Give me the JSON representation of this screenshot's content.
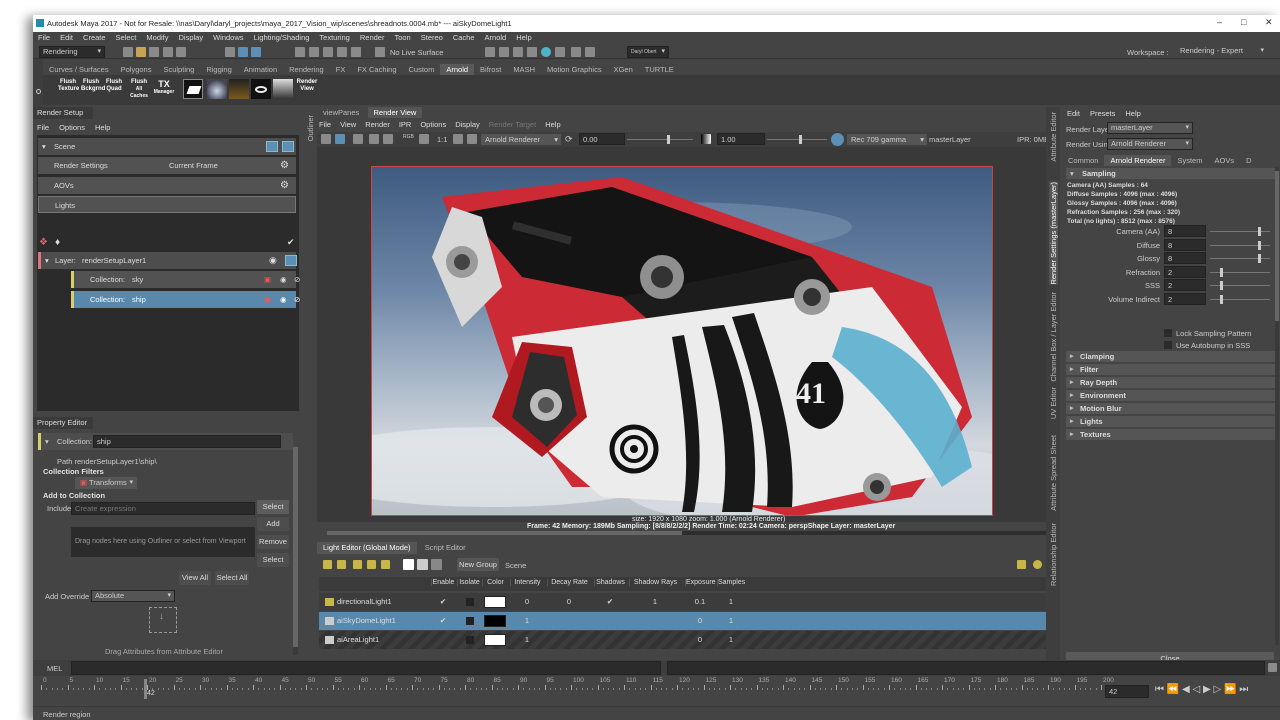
{
  "window": {
    "title": "Autodesk Maya 2017 - Not for Resale: \\\\nas\\Daryl\\daryl_projects\\maya_2017_Vision_wip\\scenes\\shreadnots.0004.mb*  ---  aiSkyDomeLight1"
  },
  "menubar": [
    "File",
    "Edit",
    "Create",
    "Select",
    "Modify",
    "Display",
    "Windows",
    "Lighting/Shading",
    "Texturing",
    "Render",
    "Toon",
    "Stereo",
    "Cache",
    "Arnold",
    "Help"
  ],
  "status": {
    "menuset": "Rendering",
    "live_surface": "No Live Surface",
    "object_field": "Daryl Obert",
    "workspace_label": "Workspace :",
    "workspace": "Rendering - Expert"
  },
  "shelf": {
    "tabs": [
      "Curves / Surfaces",
      "Polygons",
      "Sculpting",
      "Rigging",
      "Animation",
      "Rendering",
      "FX",
      "FX Caching",
      "Custom",
      "Arnold",
      "Bifrost",
      "MASH",
      "Motion Graphics",
      "XGen",
      "TURTLE"
    ],
    "active_tab": "Arnold",
    "buttons": [
      {
        "line1": "Flush",
        "line2": "Texture"
      },
      {
        "line1": "Flush",
        "line2": "Bckgrnd"
      },
      {
        "line1": "Flush",
        "line2": "Quad"
      },
      {
        "line1": "Flush",
        "line2": "All Caches"
      },
      {
        "line1": "TX",
        "line2": "Manager"
      },
      {
        "line1": "Render",
        "line2": "View"
      }
    ]
  },
  "render_setup": {
    "title": "Render Setup",
    "menu": [
      "File",
      "Options",
      "Help"
    ],
    "scene_label": "Scene",
    "render_settings": "Render Settings",
    "current_frame": "Current Frame",
    "aovs": "AOVs",
    "lights": "Lights",
    "layer_label": "Layer:",
    "layer_name": "renderSetupLayer1",
    "collections": [
      {
        "label": "Collection:",
        "name": "sky",
        "selected": false
      },
      {
        "label": "Collection:",
        "name": "ship",
        "selected": true
      }
    ]
  },
  "property_editor": {
    "title": "Property Editor",
    "collection_label": "Collection:",
    "collection_name": "ship",
    "path": "Path renderSetupLayer1\\ship\\",
    "filters_label": "Collection Filters",
    "filter_value": "Transforms",
    "add_label": "Add to Collection",
    "include_label": "Include",
    "include_placeholder": "Create expression",
    "select_btn": "Select",
    "add_btn": "Add",
    "remove_btn": "Remove",
    "select2_btn": "Select",
    "drag_hint": "Drag nodes here using Outliner or select from Viewport",
    "view_all": "View All",
    "select_all": "Select All",
    "override_label": "Add Override",
    "override_value": "Absolute",
    "drag_attr": "Drag Attributes from Attribute Editor"
  },
  "side_tabs": {
    "outliner": "Outliner"
  },
  "render_view": {
    "tabs": [
      "viewPanes",
      "Render View"
    ],
    "menu": [
      "File",
      "View",
      "Render",
      "IPR",
      "Options",
      "Display",
      "Render Target",
      "Help"
    ],
    "renderer": "Arnold Renderer",
    "exposure": "0.00",
    "gamma": "1.00",
    "color_space": "Rec 709 gamma",
    "layer": "masterLayer",
    "ipr": "IPR: 0MB",
    "info_line1": "size: 1920 x 1080  zoom: 1.000     (Arnold Renderer)",
    "info_line2": "Frame: 42     Memory: 189Mb     Sampling: [8/8/8/2/2/2]     Render Time: 02:24     Camera: perspShape     Layer: masterLayer",
    "decal_number": "41"
  },
  "light_editor": {
    "tabs": [
      "Light Editor (Global Mode)",
      "Script Editor"
    ],
    "new_group": "New Group",
    "scene": "Scene",
    "columns": [
      "Enable",
      "Isolate",
      "Color",
      "Intensity",
      "Decay Rate",
      "Shadows",
      "Shadow Rays",
      "Exposure",
      "Samples"
    ],
    "rows": [
      {
        "name": "directionalLight1",
        "enable": "✔",
        "color": "#ffffff",
        "intensity": "0",
        "decay": "0",
        "shadows": "✔",
        "rays": "1",
        "exposure": "0.1",
        "samples": "1"
      },
      {
        "name": "aiSkyDomeLight1",
        "enable": "✔",
        "color": "#000000",
        "intensity": "1",
        "decay": "",
        "shadows": "",
        "rays": "",
        "exposure": "0",
        "samples": "1"
      },
      {
        "name": "aiAreaLight1",
        "enable": "",
        "color": "#ffffff",
        "intensity": "1",
        "decay": "",
        "shadows": "",
        "rays": "",
        "exposure": "0",
        "samples": "1"
      }
    ]
  },
  "attribute_panel": {
    "menu": [
      "Edit",
      "Presets",
      "Help"
    ],
    "render_layer_label": "Render Layer",
    "render_layer": "masterLayer",
    "render_using_label": "Render Using",
    "render_using": "Arnold Renderer",
    "tabs": [
      "Common",
      "Arnold Renderer",
      "System",
      "AOVs",
      "D"
    ],
    "sampling_title": "Sampling",
    "summary": [
      "Camera (AA) Samples : 64",
      "Diffuse Samples : 4096 (max : 4096)",
      "Glossy Samples : 4096 (max : 4096)",
      "Refraction Samples : 256 (max : 320)",
      "Total (no lights) : 8512 (max : 8576)"
    ],
    "fields": [
      {
        "label": "Camera (AA)",
        "value": "8"
      },
      {
        "label": "Diffuse",
        "value": "8"
      },
      {
        "label": "Glossy",
        "value": "8"
      },
      {
        "label": "Refraction",
        "value": "2"
      },
      {
        "label": "SSS",
        "value": "2"
      },
      {
        "label": "Volume Indirect",
        "value": "2"
      }
    ],
    "checkboxes": [
      "Lock Sampling Pattern",
      "Use Autobump in SSS"
    ],
    "sections": [
      "Clamping",
      "Filter",
      "Ray Depth",
      "Environment",
      "Motion Blur",
      "Lights",
      "Textures"
    ],
    "close": "Close",
    "side_tabs": [
      "Attribute Editor",
      "Render Settings (masterLayer)",
      "Channel Box / Layer Editor",
      "UV Editor",
      "Attribute Spread Sheet",
      "Relationship Editor"
    ]
  },
  "command_line": {
    "mel": "MEL"
  },
  "timeline": {
    "current_frame": "42",
    "ticks": [
      "0",
      "5",
      "10",
      "15",
      "20",
      "25",
      "30",
      "35",
      "40",
      "45",
      "50",
      "55",
      "60",
      "65",
      "70",
      "75",
      "80",
      "85",
      "90",
      "95",
      "100",
      "105",
      "110",
      "115",
      "120",
      "125",
      "130",
      "135",
      "140",
      "145",
      "150",
      "155",
      "160",
      "165",
      "170",
      "175",
      "180",
      "185",
      "190",
      "195",
      "200"
    ],
    "marker": "42"
  },
  "help_line": "Render region"
}
